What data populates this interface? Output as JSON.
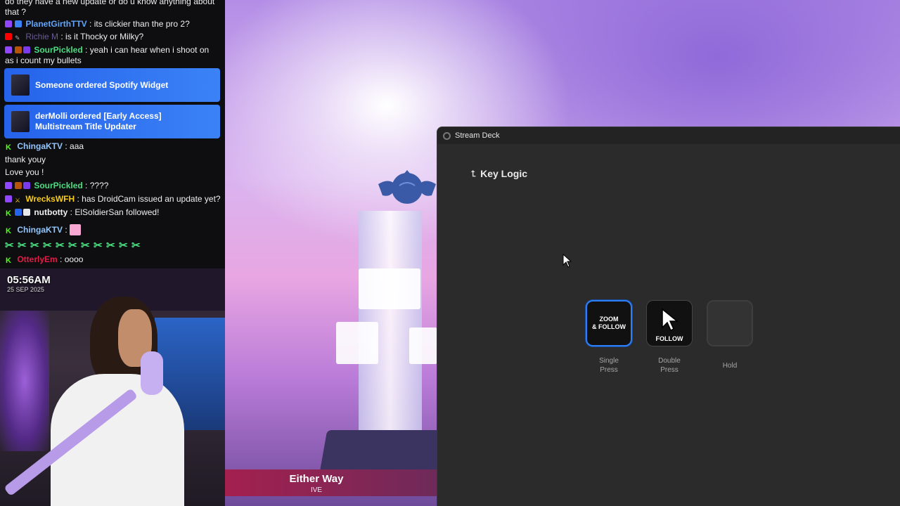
{
  "chat": {
    "messages": [
      {
        "platform": "none",
        "user": "",
        "user_color": "#efeff1",
        "text": "do they have a new update or do u know anything about that ?"
      },
      {
        "platform": "twitch",
        "user": "PlanetGirthTTV",
        "user_color": "#60a5fa",
        "text": "its clickier than the pro 2?"
      },
      {
        "platform": "youtube",
        "user": "Richie M",
        "user_color": "#6b5b95",
        "text": "is it Thocky or Milky?"
      },
      {
        "platform": "twitch",
        "user": "SourPickled",
        "user_color": "#4ade80",
        "text": "yeah i can hear when i shoot on as i count my bullets"
      },
      {
        "platform": "kick",
        "user": "ChingaKTV",
        "user_color": "#93c5fd",
        "text": "aaa"
      },
      {
        "platform": "none",
        "user": "",
        "user_color": "#efeff1",
        "text": "thank youy"
      },
      {
        "platform": "none",
        "user": "",
        "user_color": "#efeff1",
        "text": "Love you !"
      },
      {
        "platform": "twitch",
        "user": "SourPickled",
        "user_color": "#4ade80",
        "text": "????"
      },
      {
        "platform": "twitch",
        "user": "WrecksWFH",
        "user_color": "#facc15",
        "text": "has DroidCam issued an update yet?"
      },
      {
        "platform": "kick",
        "user": "nutbotty",
        "user_color": "#efeff1",
        "text": "ElSoldierSan followed!"
      },
      {
        "platform": "kick",
        "user": "ChingaKTV",
        "user_color": "#93c5fd",
        "text": ""
      },
      {
        "platform": "kick",
        "user": "OtterlyEm",
        "user_color": "#e11d48",
        "text": "oooo"
      }
    ],
    "events": [
      {
        "text": "Someone ordered Spotify Widget"
      },
      {
        "text": "derMolli ordered [Early Access] Multistream Title Updater"
      }
    ],
    "emote_glyph": "✂"
  },
  "webcam": {
    "time": "05:56AM",
    "date": "25 SEP 2025"
  },
  "now_playing": {
    "title": "Either Way",
    "artist": "IVE"
  },
  "stream_deck": {
    "window_title": "Stream Deck",
    "back_label": "Key Logic",
    "keys": [
      {
        "label": "Single Press",
        "icon_text": "ZOOM & FOLLOW",
        "state": "selected"
      },
      {
        "label": "Double Press",
        "icon_text": "FOLLOW",
        "state": "normal"
      },
      {
        "label": "Hold",
        "icon_text": "",
        "state": "empty"
      }
    ]
  },
  "colors": {
    "accent": "#2e7ff6",
    "event_blue": "#3b82f6",
    "twitch": "#9146ff",
    "kick": "#53fc18"
  }
}
